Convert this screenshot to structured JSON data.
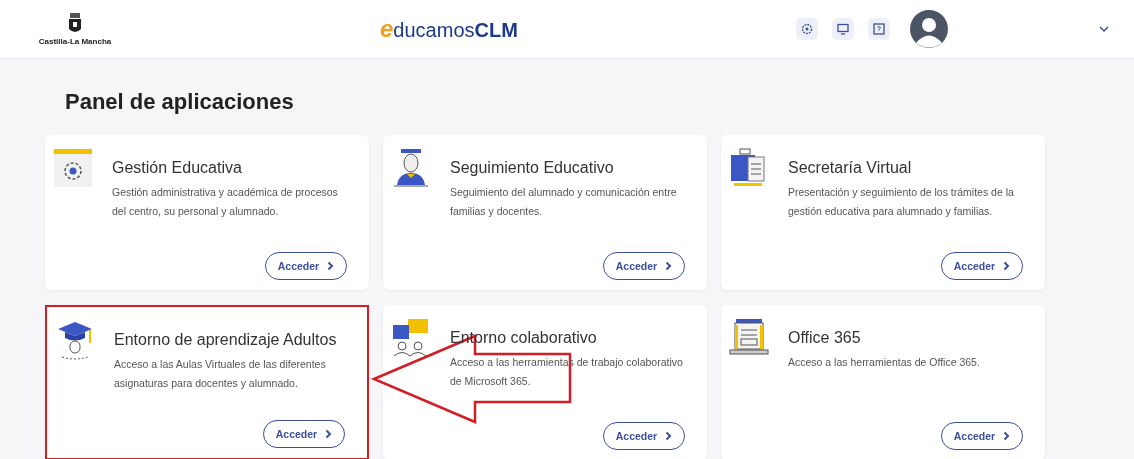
{
  "header": {
    "region_logo": "Castilla-La Mancha",
    "brand": {
      "mark": "e",
      "name": "ducamos",
      "suffix": "CLM"
    }
  },
  "title": "Panel de aplicaciones",
  "apps": [
    {
      "kind": "gear",
      "title": "Gestión Educativa",
      "description": "Gestión administrativa y académica de procesos del centro, su personal y alumnado.",
      "button": "Acceder",
      "highlighted": false
    },
    {
      "kind": "graduate",
      "title": "Seguimiento Educativo",
      "description": "Seguimiento del alumnado y comunicación entre familias y docentes.",
      "button": "Acceder",
      "highlighted": false
    },
    {
      "kind": "briefcase",
      "title": "Secretaría Virtual",
      "description": "Presentación y seguimiento de los trámites de la gestión educativa para alumnado y familias.",
      "button": "Acceder",
      "highlighted": false
    },
    {
      "kind": "cap",
      "title": "Entorno de aprendizaje Adultos",
      "description": "Acceso a las Aulas Virtuales de las diferentes asignaturas para docentes y alumnado.",
      "button": "Acceder",
      "highlighted": true
    },
    {
      "kind": "chat",
      "title": "Entorno colaborativo",
      "description": "Acceso a las herramientas de trabajo colaborativo de Microsoft 365.",
      "button": "Acceder",
      "highlighted": false
    },
    {
      "kind": "laptop",
      "title": "Office 365",
      "description": "Acceso a las herramientas de Office 365.",
      "button": "Acceder",
      "highlighted": false
    }
  ],
  "annotation_arrow": true
}
